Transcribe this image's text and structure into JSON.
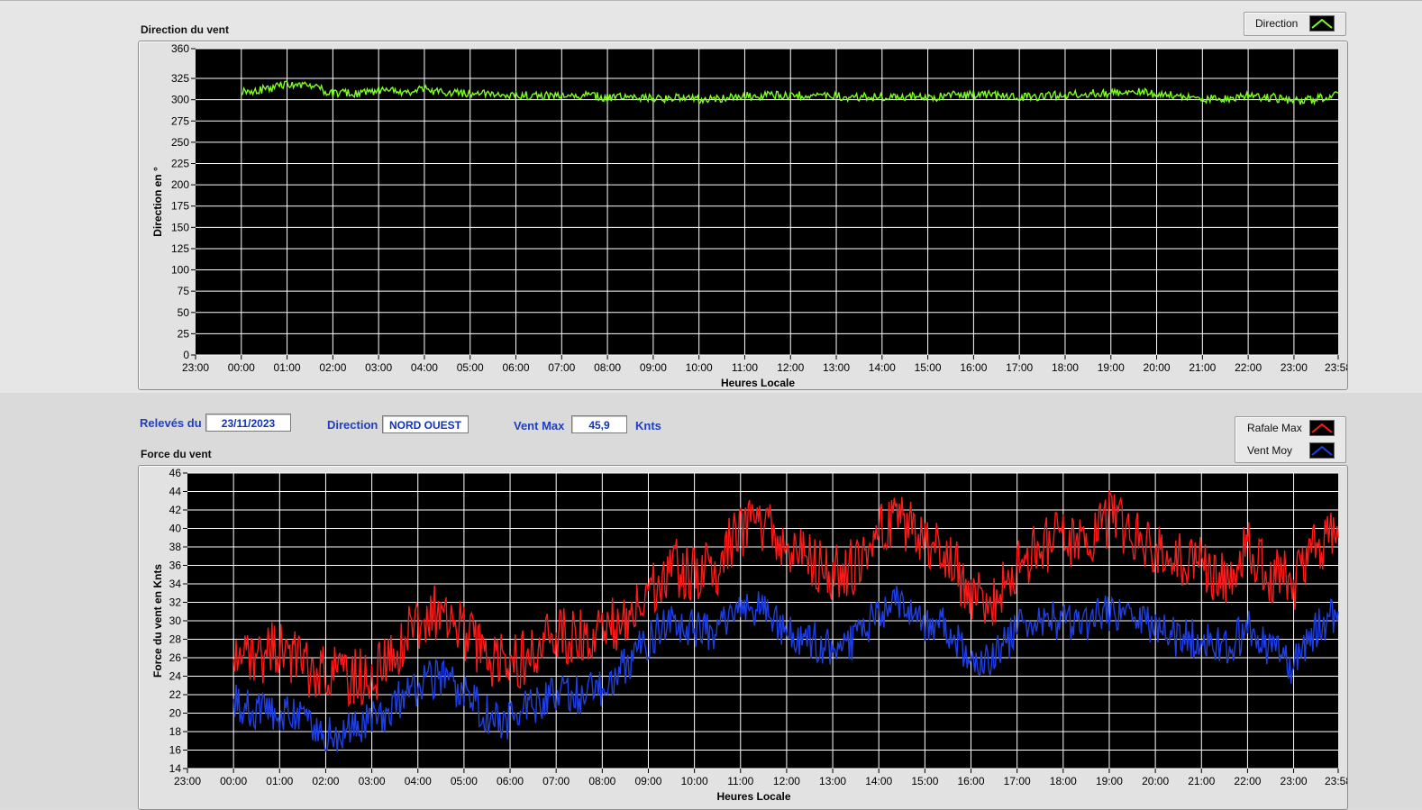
{
  "panels": {
    "direction_title": "Direction du vent",
    "force_title": "Force du vent"
  },
  "legends": {
    "direction_label": "Direction",
    "gust_label": "Rafale Max",
    "mean_label": "Vent Moy"
  },
  "info": {
    "date_label": "Relevés du",
    "date_value": "23/11/2023",
    "direction_label": "Direction",
    "direction_value": "NORD OUEST",
    "max_label": "Vent Max",
    "max_value": "45,9",
    "max_unit": "Knts"
  },
  "colors": {
    "plot_background": "#000000",
    "grid": "#ffffff",
    "direction": "#7cff1e",
    "gust": "#ff1a1a",
    "mean": "#1f3fe6"
  },
  "chart_data": [
    {
      "type": "line",
      "title": "Direction du vent",
      "xlabel": "Heures Locale",
      "ylabel": "Direction en °",
      "ylim": [
        0,
        360
      ],
      "xlim": [
        "23:00",
        "23:58"
      ],
      "yticks": [
        "0",
        "25",
        "50",
        "75",
        "100",
        "125",
        "150",
        "175",
        "200",
        "225",
        "250",
        "275",
        "300",
        "325",
        "360"
      ],
      "xticks": [
        "23:00",
        "00:00",
        "01:00",
        "02:00",
        "03:00",
        "04:00",
        "05:00",
        "06:00",
        "07:00",
        "08:00",
        "09:00",
        "10:00",
        "11:00",
        "12:00",
        "13:00",
        "14:00",
        "15:00",
        "16:00",
        "17:00",
        "18:00",
        "19:00",
        "20:00",
        "21:00",
        "22:00",
        "23:00",
        "23:58"
      ],
      "grid": true,
      "legend_position": "top-right",
      "series": [
        {
          "name": "Direction",
          "x": [
            "00:00",
            "00:30",
            "01:00",
            "01:30",
            "02:00",
            "02:30",
            "03:00",
            "03:30",
            "04:00",
            "04:30",
            "05:00",
            "05:30",
            "06:00",
            "06:30",
            "07:00",
            "07:30",
            "08:00",
            "08:30",
            "09:00",
            "09:30",
            "10:00",
            "10:30",
            "11:00",
            "11:30",
            "12:00",
            "12:30",
            "13:00",
            "13:30",
            "14:00",
            "14:30",
            "15:00",
            "15:30",
            "16:00",
            "16:30",
            "17:00",
            "17:30",
            "18:00",
            "18:30",
            "19:00",
            "19:30",
            "20:00",
            "20:30",
            "21:00",
            "21:30",
            "22:00",
            "22:30",
            "23:00",
            "23:30",
            "23:58"
          ],
          "values": [
            310,
            312,
            318,
            316,
            308,
            307,
            311,
            309,
            312,
            308,
            307,
            306,
            305,
            305,
            303,
            306,
            302,
            303,
            301,
            302,
            300,
            302,
            304,
            305,
            305,
            306,
            304,
            303,
            303,
            304,
            302,
            305,
            306,
            305,
            303,
            304,
            306,
            307,
            308,
            309,
            307,
            306,
            300,
            302,
            304,
            303,
            298,
            301,
            308
          ]
        }
      ]
    },
    {
      "type": "line",
      "title": "Force du vent",
      "xlabel": "Heures Locale",
      "ylabel": "Force du vent en Knts",
      "ylim": [
        14,
        46
      ],
      "xlim": [
        "23:00",
        "23:58"
      ],
      "yticks": [
        "14",
        "16",
        "18",
        "20",
        "22",
        "24",
        "26",
        "28",
        "30",
        "32",
        "34",
        "36",
        "38",
        "40",
        "42",
        "44",
        "46"
      ],
      "xticks": [
        "23:00",
        "00:00",
        "01:00",
        "02:00",
        "03:00",
        "04:00",
        "05:00",
        "06:00",
        "07:00",
        "08:00",
        "09:00",
        "10:00",
        "11:00",
        "12:00",
        "13:00",
        "14:00",
        "15:00",
        "16:00",
        "17:00",
        "18:00",
        "19:00",
        "20:00",
        "21:00",
        "22:00",
        "23:00",
        "23:58"
      ],
      "grid": true,
      "legend_position": "top-right",
      "series": [
        {
          "name": "Rafale Max",
          "x": [
            "00:00",
            "00:30",
            "01:00",
            "01:30",
            "02:00",
            "02:30",
            "03:00",
            "03:30",
            "04:00",
            "04:30",
            "05:00",
            "05:30",
            "06:00",
            "06:30",
            "07:00",
            "07:30",
            "08:00",
            "08:30",
            "09:00",
            "09:30",
            "10:00",
            "10:30",
            "11:00",
            "11:30",
            "12:00",
            "12:30",
            "13:00",
            "13:30",
            "14:00",
            "14:30",
            "15:00",
            "15:30",
            "16:00",
            "16:30",
            "17:00",
            "17:30",
            "18:00",
            "18:30",
            "19:00",
            "19:30",
            "20:00",
            "20:30",
            "21:00",
            "21:30",
            "22:00",
            "22:30",
            "23:00",
            "23:30",
            "23:58"
          ],
          "values": [
            26,
            26,
            27,
            25,
            24,
            24,
            24,
            26,
            30,
            31,
            29,
            26,
            25,
            27,
            28,
            29,
            28,
            31,
            33,
            36,
            35,
            36,
            40,
            40,
            38,
            37,
            35,
            36,
            40,
            41,
            39,
            37,
            33,
            32,
            36,
            38,
            39,
            39,
            41,
            40,
            38,
            37,
            36,
            34,
            38,
            35,
            34,
            38,
            39
          ]
        },
        {
          "name": "Vent Moy",
          "x": [
            "00:00",
            "00:30",
            "01:00",
            "01:30",
            "02:00",
            "02:30",
            "03:00",
            "03:30",
            "04:00",
            "04:30",
            "05:00",
            "05:30",
            "06:00",
            "06:30",
            "07:00",
            "07:30",
            "08:00",
            "08:30",
            "09:00",
            "09:30",
            "10:00",
            "10:30",
            "11:00",
            "11:30",
            "12:00",
            "12:30",
            "13:00",
            "13:30",
            "14:00",
            "14:30",
            "15:00",
            "15:30",
            "16:00",
            "16:30",
            "17:00",
            "17:30",
            "18:00",
            "18:30",
            "19:00",
            "19:30",
            "20:00",
            "20:30",
            "21:00",
            "21:30",
            "22:00",
            "22:30",
            "23:00",
            "23:30",
            "23:58"
          ],
          "values": [
            21,
            20,
            20,
            19,
            18,
            18,
            19,
            21,
            23,
            24,
            22,
            20,
            19,
            21,
            22,
            22,
            23,
            25,
            28,
            30,
            29,
            29,
            32,
            31,
            29,
            28,
            27,
            28,
            31,
            32,
            30,
            29,
            26,
            26,
            29,
            30,
            30,
            30,
            31,
            31,
            29,
            28,
            28,
            27,
            29,
            27,
            25,
            29,
            31
          ]
        }
      ]
    }
  ]
}
